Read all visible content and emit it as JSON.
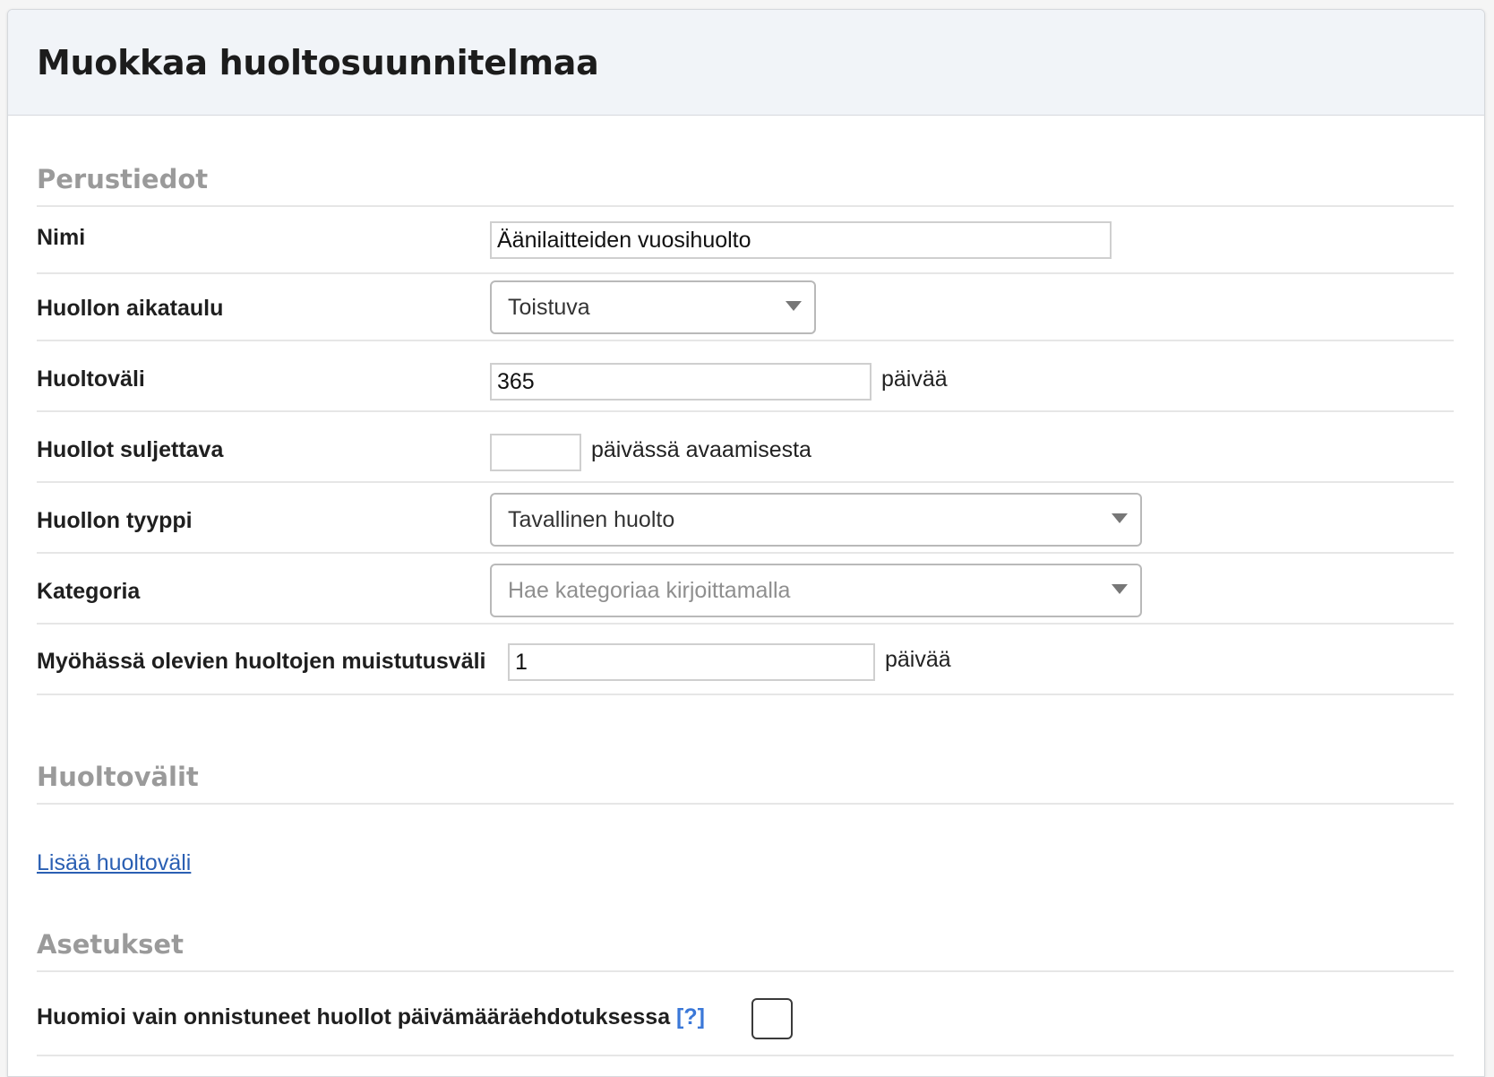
{
  "header": {
    "title": "Muokkaa huoltosuunnitelmaa"
  },
  "sections": {
    "basic": "Perustiedot",
    "intervals": "Huoltovälit",
    "settings": "Asetukset"
  },
  "form": {
    "name": {
      "label": "Nimi",
      "value": "Äänilaitteiden vuosihuolto"
    },
    "schedule": {
      "label": "Huollon aikataulu",
      "selected": "Toistuva"
    },
    "interval": {
      "label": "Huoltoväli",
      "value": "365",
      "unit": "päivää"
    },
    "close_within": {
      "label": "Huollot suljettava",
      "value": "",
      "unit": "päivässä avaamisesta"
    },
    "type": {
      "label": "Huollon tyyppi",
      "selected": "Tavallinen huolto"
    },
    "category": {
      "label": "Kategoria",
      "placeholder": "Hae kategoriaa kirjoittamalla"
    },
    "reminder": {
      "label": "Myöhässä olevien huoltojen muistutusväli",
      "value": "1",
      "unit": "päivää"
    }
  },
  "intervals": {
    "add_link": "Lisää huoltoväli"
  },
  "settings": {
    "successful_only": {
      "label": "Huomioi vain onnistuneet huollot päivämääräehdotuksessa",
      "help": "[?]",
      "checked": false
    }
  }
}
